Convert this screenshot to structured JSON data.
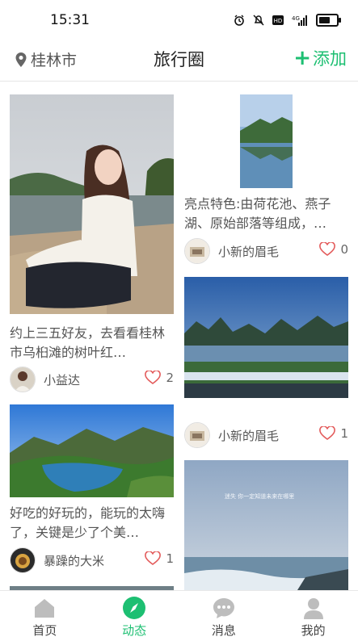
{
  "status_bar": {
    "time": "15:31",
    "icons": [
      "alarm-icon",
      "mute-icon",
      "hd-icon",
      "signal-icon",
      "battery-icon"
    ],
    "signal_label": "4G",
    "hd_label": "HD",
    "battery_level": 0.65
  },
  "header": {
    "location": "桂林市",
    "title": "旅行圈",
    "add_label": "添加",
    "add_plus": "+"
  },
  "colors": {
    "accent": "#1dbf72",
    "heart": "#e35a5a",
    "text": "#555555"
  },
  "posts": [
    {
      "text": "约上三五好友，去看看桂林市乌桕滩的树叶红…",
      "author": "小益达",
      "likes": "2",
      "image": "photo-girl-riverside"
    },
    {
      "text": "好吃的好玩的，能玩的太嗨了，关键是少了个美…",
      "author": "暴躁的大米",
      "likes": "1",
      "image": "photo-lake-mountains"
    },
    {
      "text": "亮点特色:由荷花池、燕子湖、原始部落等组成，…",
      "author": "小新的眉毛",
      "likes": "0",
      "image": "photo-karst-reflection"
    },
    {
      "text": "",
      "author": "小新的眉毛",
      "likes": "1",
      "image": "photo-li-river-stage"
    },
    {
      "overlay_text": "迷失  你一定知道未来在哪里",
      "image": "photo-sea-sky"
    }
  ],
  "tabs": [
    {
      "label": "首页",
      "icon": "home-icon",
      "active": false
    },
    {
      "label": "动态",
      "icon": "compass-icon",
      "active": true
    },
    {
      "label": "消息",
      "icon": "chat-icon",
      "active": false
    },
    {
      "label": "我的",
      "icon": "profile-icon",
      "active": false
    }
  ]
}
